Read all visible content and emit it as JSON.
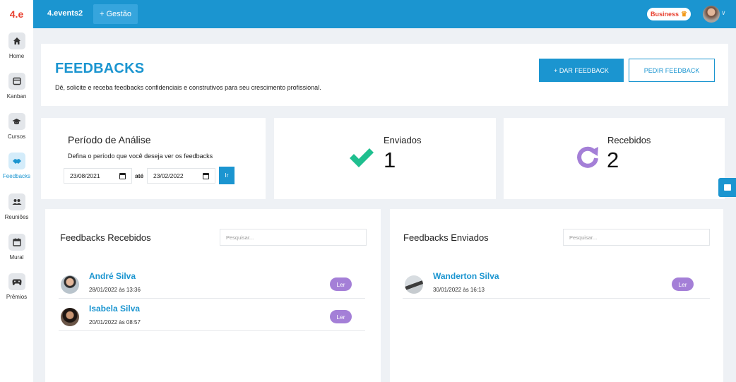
{
  "topbar": {
    "logo": "4.e",
    "app_name": "4.events2",
    "gestao_label": "+ Gestão",
    "business_label": "Business"
  },
  "sidebar": {
    "items": [
      {
        "label": "Home",
        "icon": "home-icon"
      },
      {
        "label": "Kanban",
        "icon": "kanban-icon"
      },
      {
        "label": "Cursos",
        "icon": "graduation-cap-icon"
      },
      {
        "label": "Feedbacks",
        "icon": "handshake-icon",
        "active": true
      },
      {
        "label": "Reuniões",
        "icon": "people-icon"
      },
      {
        "label": "Mural",
        "icon": "calendar-icon"
      },
      {
        "label": "Prêmios",
        "icon": "gamepad-icon"
      }
    ]
  },
  "header": {
    "title": "FEEDBACKS",
    "subtitle": "Dê, solicite e receba feedbacks confidenciais e construtivos para seu crescimento profissional.",
    "give_button": "+ DAR FEEDBACK",
    "ask_button": "PEDIR FEEDBACK"
  },
  "period": {
    "title": "Período de Análise",
    "subtitle": "Defina o período que você deseja ver os feedbacks",
    "from_date": "23/08/2021",
    "to_label": "até",
    "to_date": "23/02/2022",
    "go_button": "Ir"
  },
  "stats": {
    "sent_label": "Enviados",
    "sent_value": "1",
    "received_label": "Recebidos",
    "received_value": "2"
  },
  "received_list": {
    "title": "Feedbacks Recebidos",
    "search_placeholder": "Pesquisar...",
    "items": [
      {
        "name": "André Silva",
        "date": "28/01/2022 às 13:36",
        "action": "Ler"
      },
      {
        "name": "Isabela Silva",
        "date": "20/01/2022 às 08:57",
        "action": "Ler"
      }
    ]
  },
  "sent_list": {
    "title": "Feedbacks Enviados",
    "search_placeholder": "Pesquisar...",
    "items": [
      {
        "name": "Wanderton Silva",
        "date": "30/01/2022 às 16:13",
        "action": "Ler"
      }
    ]
  },
  "colors": {
    "primary": "#1b95d0",
    "check": "#1fbf8f",
    "refresh": "#a47fd7",
    "read_button": "#a47fd7"
  }
}
